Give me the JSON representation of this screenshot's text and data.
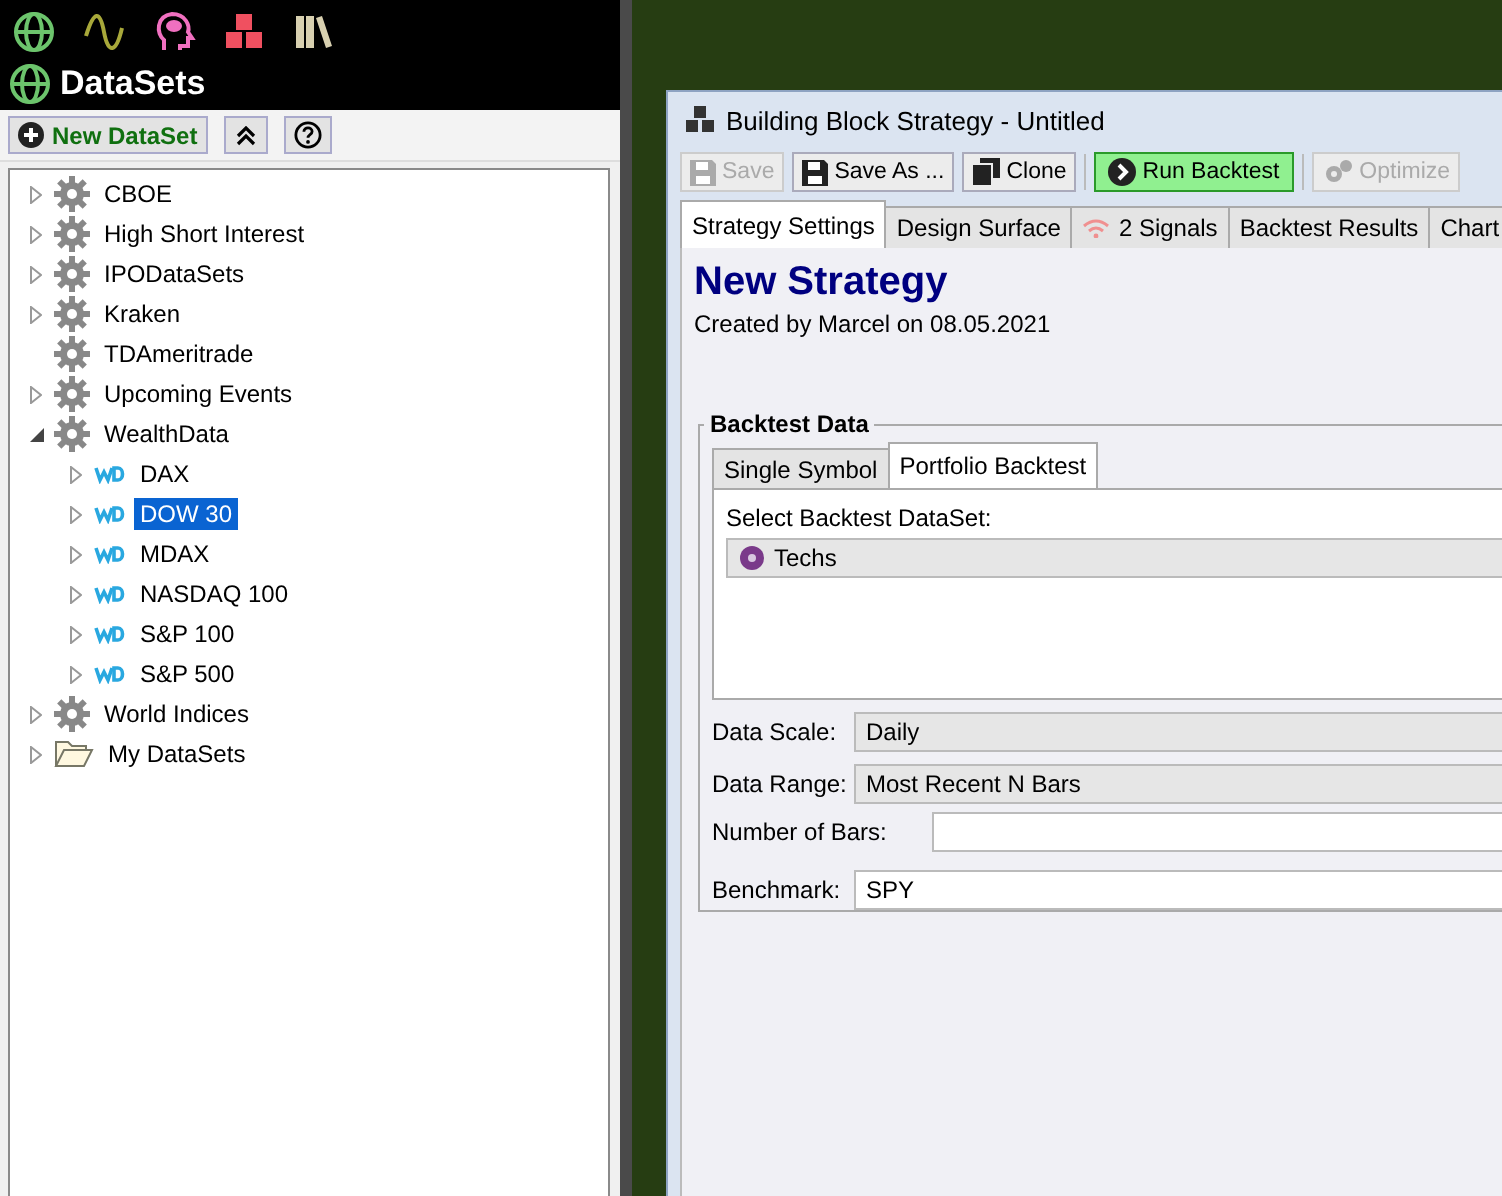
{
  "app_toolbar": {
    "icons": [
      {
        "kind": "globe",
        "color": "#6cc46c"
      },
      {
        "kind": "wave",
        "color": "#a8a83a"
      },
      {
        "kind": "head",
        "color": "#f070c0"
      },
      {
        "kind": "cubes",
        "color": "#f05060"
      },
      {
        "kind": "books",
        "color": "#d8d0b0"
      }
    ]
  },
  "datasets_panel": {
    "title": "DataSets",
    "buttons": [
      {
        "kind": "new",
        "label": "New DataSet"
      },
      {
        "kind": "collapse"
      },
      {
        "kind": "help"
      }
    ],
    "tree": [
      {
        "label": "CBOE",
        "kind": "gear",
        "expanded": false,
        "selected": false
      },
      {
        "label": "High Short Interest",
        "kind": "gear",
        "expanded": false,
        "selected": false
      },
      {
        "label": "IPODataSets",
        "kind": "gear",
        "expanded": false,
        "selected": false
      },
      {
        "label": "Kraken",
        "kind": "gear",
        "expanded": false,
        "selected": false
      },
      {
        "label": "TDAmeritrade",
        "kind": "gear",
        "selected": false
      },
      {
        "label": "Upcoming Events",
        "kind": "gear",
        "expanded": false,
        "selected": false
      },
      {
        "label": "WealthData",
        "kind": "gear",
        "expanded": true,
        "selected": false,
        "children": [
          {
            "label": "DAX",
            "kind": "wd",
            "expanded": false,
            "selected": false
          },
          {
            "label": "DOW 30",
            "kind": "wd",
            "expanded": false,
            "selected": true
          },
          {
            "label": "MDAX",
            "kind": "wd",
            "expanded": false,
            "selected": false
          },
          {
            "label": "NASDAQ 100",
            "kind": "wd",
            "expanded": false,
            "selected": false
          },
          {
            "label": "S&P 100",
            "kind": "wd",
            "expanded": false,
            "selected": false
          },
          {
            "label": "S&P 500",
            "kind": "wd",
            "expanded": false,
            "selected": false
          }
        ]
      },
      {
        "label": "World Indices",
        "kind": "gear",
        "expanded": false,
        "selected": false
      },
      {
        "label": "My DataSets",
        "kind": "folder",
        "expanded": false,
        "selected": false
      }
    ]
  },
  "window": {
    "title": "Building Block Strategy - Untitled",
    "toolbar": [
      {
        "kind": "save",
        "label": "Save",
        "disabled": true
      },
      {
        "kind": "save",
        "label": "Save As ...",
        "disabled": false
      },
      {
        "kind": "clone",
        "label": "Clone",
        "disabled": false
      },
      {
        "kind": "run",
        "label": "Run Backtest",
        "disabled": false
      },
      {
        "kind": "optimize",
        "label": "Optimize",
        "disabled": true
      }
    ],
    "tabs": [
      {
        "label": "Strategy Settings",
        "selected": true
      },
      {
        "label": "Design Surface",
        "selected": false
      },
      {
        "label": "2 Signals",
        "selected": false,
        "kind": "signals"
      },
      {
        "label": "Backtest Results",
        "selected": false
      },
      {
        "label": "Chart",
        "selected": false
      }
    ],
    "strategy_name": "New Strategy",
    "created": "Created by Marcel on 08.05.2021",
    "backtest_data": {
      "title": "Backtest Data",
      "tabs": [
        {
          "label": "Single Symbol",
          "selected": false
        },
        {
          "label": "Portfolio Backtest",
          "selected": true
        }
      ],
      "select_label": "Select Backtest DataSet:",
      "dataset": "Techs",
      "fields": [
        {
          "label": "Data Scale:",
          "kind": "dropdown",
          "value": "Daily"
        },
        {
          "label": "Data Range:",
          "kind": "dropdown",
          "value": "Most Recent N Bars"
        },
        {
          "label": "Number of Bars:",
          "kind": "input"
        },
        {
          "label": "Benchmark:",
          "kind": "input",
          "value": "SPY"
        }
      ]
    }
  }
}
